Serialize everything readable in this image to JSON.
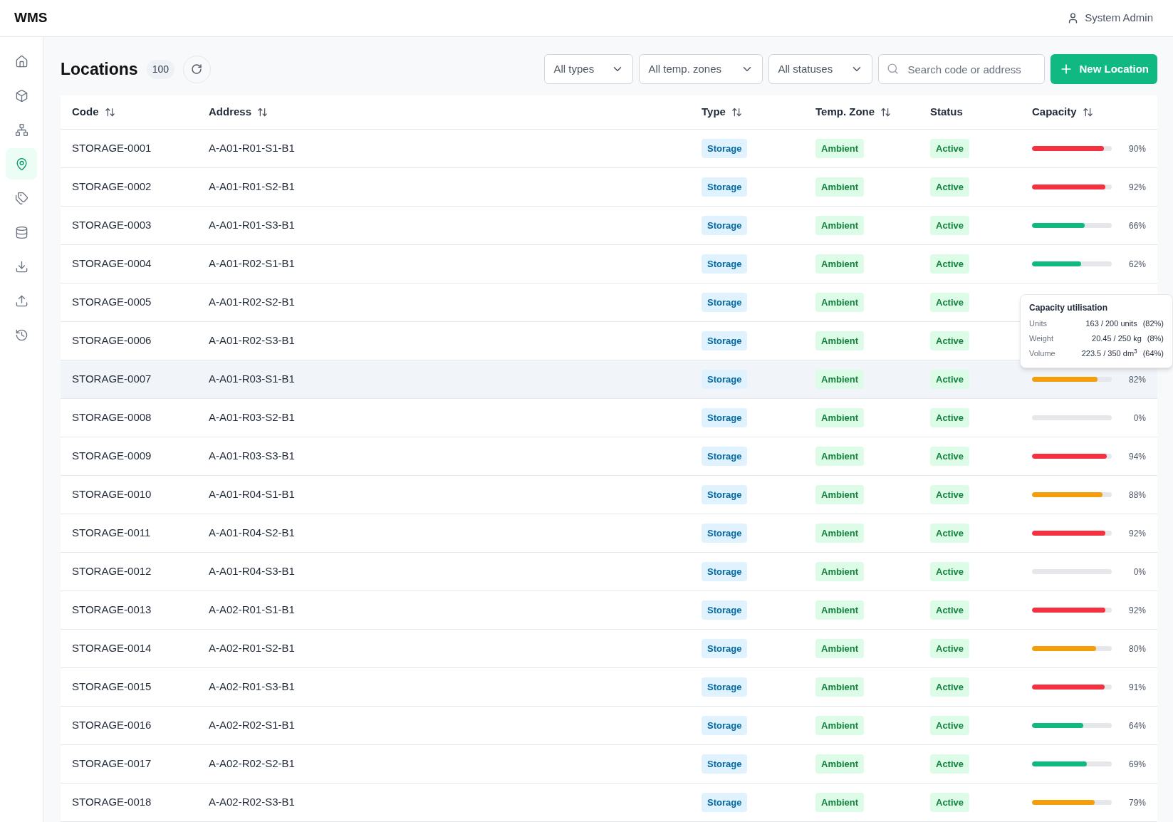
{
  "app": {
    "title": "WMS",
    "user": "System Admin"
  },
  "sidebar": {
    "items": [
      {
        "selected": false
      },
      {
        "selected": false
      },
      {
        "selected": false
      },
      {
        "selected": true
      },
      {
        "selected": false
      },
      {
        "selected": false
      },
      {
        "selected": false
      },
      {
        "selected": false
      },
      {
        "selected": false
      }
    ]
  },
  "page": {
    "title": "Locations",
    "count": "100"
  },
  "filters": [
    "All types",
    "All temp. zones",
    "All statuses"
  ],
  "search": {
    "placeholder": "Search code or address"
  },
  "new_button": "New Location",
  "table": {
    "columns": [
      {
        "label": "Code",
        "sortable": true
      },
      {
        "label": "Address",
        "sortable": true
      },
      {
        "label": "Type",
        "sortable": true
      },
      {
        "label": "Temp. Zone",
        "sortable": true
      },
      {
        "label": "Status",
        "sortable": false
      },
      {
        "label": "Capacity",
        "sortable": true
      }
    ],
    "rows": [
      {
        "code": "STORAGE-0001",
        "address": "A-A01-R01-S1-B1",
        "type": "Storage",
        "zone": "Ambient",
        "status": "Active",
        "highlighted": false,
        "capacity": {
          "level": 0.9,
          "reading": "90%"
        }
      },
      {
        "code": "STORAGE-0002",
        "address": "A-A01-R01-S2-B1",
        "type": "Storage",
        "zone": "Ambient",
        "status": "Active",
        "highlighted": false,
        "capacity": {
          "level": 0.92,
          "reading": "92%"
        }
      },
      {
        "code": "STORAGE-0003",
        "address": "A-A01-R01-S3-B1",
        "type": "Storage",
        "zone": "Ambient",
        "status": "Active",
        "highlighted": false,
        "capacity": {
          "level": 0.66,
          "reading": "66%"
        }
      },
      {
        "code": "STORAGE-0004",
        "address": "A-A01-R02-S1-B1",
        "type": "Storage",
        "zone": "Ambient",
        "status": "Active",
        "highlighted": false,
        "capacity": {
          "level": 0.62,
          "reading": "62%"
        }
      },
      {
        "code": "STORAGE-0005",
        "address": "A-A01-R02-S2-B1",
        "type": "Storage",
        "zone": "Ambient",
        "status": "Active",
        "highlighted": false
      },
      {
        "code": "STORAGE-0006",
        "address": "A-A01-R02-S3-B1",
        "type": "Storage",
        "zone": "Ambient",
        "status": "Active",
        "highlighted": false
      },
      {
        "code": "STORAGE-0007",
        "address": "A-A01-R03-S1-B1",
        "type": "Storage",
        "zone": "Ambient",
        "status": "Active",
        "highlighted": true,
        "capacity": {
          "level": 0.82,
          "reading": "82%"
        }
      },
      {
        "code": "STORAGE-0008",
        "address": "A-A01-R03-S2-B1",
        "type": "Storage",
        "zone": "Ambient",
        "status": "Active",
        "highlighted": false,
        "capacity": {
          "reading": "0%"
        }
      },
      {
        "code": "STORAGE-0009",
        "address": "A-A01-R03-S3-B1",
        "type": "Storage",
        "zone": "Ambient",
        "status": "Active",
        "highlighted": false,
        "capacity": {
          "level": 0.94,
          "reading": "94%"
        }
      },
      {
        "code": "STORAGE-0010",
        "address": "A-A01-R04-S1-B1",
        "type": "Storage",
        "zone": "Ambient",
        "status": "Active",
        "highlighted": false,
        "capacity": {
          "level": 0.88,
          "reading": "88%"
        }
      },
      {
        "code": "STORAGE-0011",
        "address": "A-A01-R04-S2-B1",
        "type": "Storage",
        "zone": "Ambient",
        "status": "Active",
        "highlighted": false,
        "capacity": {
          "level": 0.92,
          "reading": "92%"
        }
      },
      {
        "code": "STORAGE-0012",
        "address": "A-A01-R04-S3-B1",
        "type": "Storage",
        "zone": "Ambient",
        "status": "Active",
        "highlighted": false,
        "capacity": {
          "reading": "0%"
        }
      },
      {
        "code": "STORAGE-0013",
        "address": "A-A02-R01-S1-B1",
        "type": "Storage",
        "zone": "Ambient",
        "status": "Active",
        "highlighted": false,
        "capacity": {
          "level": 0.92,
          "reading": "92%"
        }
      },
      {
        "code": "STORAGE-0014",
        "address": "A-A02-R01-S2-B1",
        "type": "Storage",
        "zone": "Ambient",
        "status": "Active",
        "highlighted": false,
        "capacity": {
          "level": 0.8,
          "reading": "80%"
        }
      },
      {
        "code": "STORAGE-0015",
        "address": "A-A02-R01-S3-B1",
        "type": "Storage",
        "zone": "Ambient",
        "status": "Active",
        "highlighted": false,
        "capacity": {
          "level": 0.91,
          "reading": "91%"
        }
      },
      {
        "code": "STORAGE-0016",
        "address": "A-A02-R02-S1-B1",
        "type": "Storage",
        "zone": "Ambient",
        "status": "Active",
        "highlighted": false,
        "capacity": {
          "level": 0.64,
          "reading": "64%"
        }
      },
      {
        "code": "STORAGE-0017",
        "address": "A-A02-R02-S2-B1",
        "type": "Storage",
        "zone": "Ambient",
        "status": "Active",
        "highlighted": false,
        "capacity": {
          "level": 0.69,
          "reading": "69%"
        }
      },
      {
        "code": "STORAGE-0018",
        "address": "A-A02-R02-S3-B1",
        "type": "Storage",
        "zone": "Ambient",
        "status": "Active",
        "highlighted": false,
        "capacity": {
          "level": 0.79,
          "reading": "79%"
        }
      }
    ]
  },
  "tooltip": {
    "title": "Capacity utilisation",
    "rows": [
      {
        "label": "Units",
        "value": "163 / 200 units",
        "percent": "(82%)"
      },
      {
        "label": "Weight",
        "value": "20.45 / 250 kg",
        "percent": "(8%)"
      },
      {
        "label": "Volume",
        "value": "223.5 / 350 dm$^{3}$",
        "percent": "(64%)"
      }
    ]
  }
}
